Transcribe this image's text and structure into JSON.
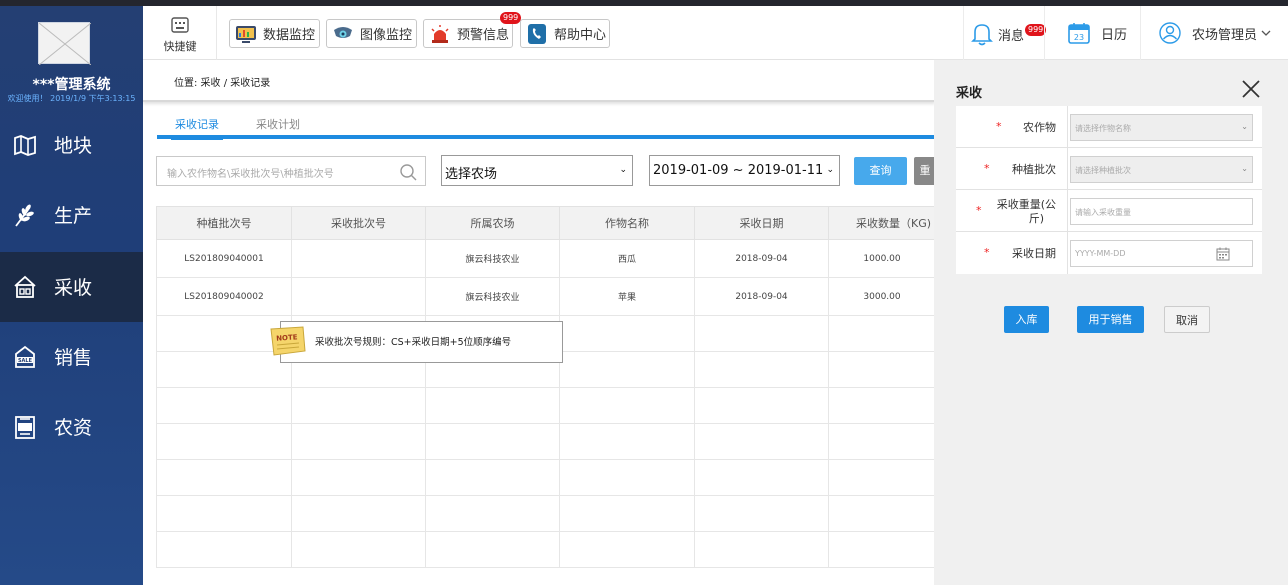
{
  "sidebar": {
    "title": "***管理系统",
    "welcome": "欢迎使用！ 2019/1/9  下午3:13:15",
    "items": [
      {
        "label": "地块",
        "icon": "map-icon"
      },
      {
        "label": "生产",
        "icon": "wheat-icon"
      },
      {
        "label": "采收",
        "icon": "harvest-house-icon"
      },
      {
        "label": "销售",
        "icon": "sale-icon"
      },
      {
        "label": "农资",
        "icon": "agri-supply-icon"
      }
    ]
  },
  "topbar": {
    "shortcut_label": "快捷键",
    "buttons": [
      {
        "label": "数据监控",
        "icon": "data-monitor-icon"
      },
      {
        "label": "图像监控",
        "icon": "camera-icon"
      },
      {
        "label": "预警信息",
        "icon": "alarm-icon",
        "badge": "999"
      },
      {
        "label": "帮助中心",
        "icon": "help-phone-icon"
      }
    ],
    "messages_label": "消息",
    "messages_badge": "999",
    "calendar_label": "日历",
    "calendar_day": "23",
    "user_label": "农场管理员"
  },
  "breadcrumb": {
    "text": "位置:  采收   /   采收记录"
  },
  "tabs": [
    "采收记录",
    "采收计划"
  ],
  "filters": {
    "search_placeholder": "输入农作物名\\采收批次号\\种植批次号",
    "farm_select": "选择农场",
    "date_range": "2019-01-09 ~ 2019-01-11",
    "query_label": "查询",
    "reset_label": "重"
  },
  "table": {
    "columns": [
      "种植批次号",
      "采收批次号",
      "所属农场",
      "作物名称",
      "采收日期",
      "采收数量（KG)"
    ],
    "rows": [
      [
        "LS201809040001",
        "",
        "旗云科技农业",
        "西瓜",
        "2018-09-04",
        "1000.00"
      ],
      [
        "LS201809040002",
        "",
        "旗云科技农业",
        "苹果",
        "2018-09-04",
        "3000.00"
      ]
    ]
  },
  "note": {
    "icon_text": "NOTE",
    "text": "采收批次号规则：CS+采收日期+5位顺序编号"
  },
  "panel": {
    "title": "采收",
    "fields": [
      {
        "label": "农作物",
        "placeholder": "请选择作物名称"
      },
      {
        "label": "种植批次",
        "placeholder": "请选择种植批次"
      },
      {
        "label_line1": "采收重量(公",
        "label_line2": "斤)",
        "placeholder": "请输入采收重量"
      },
      {
        "label": "采收日期",
        "placeholder": "YYYY-MM-DD"
      }
    ],
    "required_mark": "*",
    "store_label": "入库",
    "sale_label": "用于销售",
    "cancel_label": "取消"
  },
  "colors": {
    "sidebar": "#243f73",
    "accent": "#1e8be0",
    "badge": "#e0141b"
  }
}
